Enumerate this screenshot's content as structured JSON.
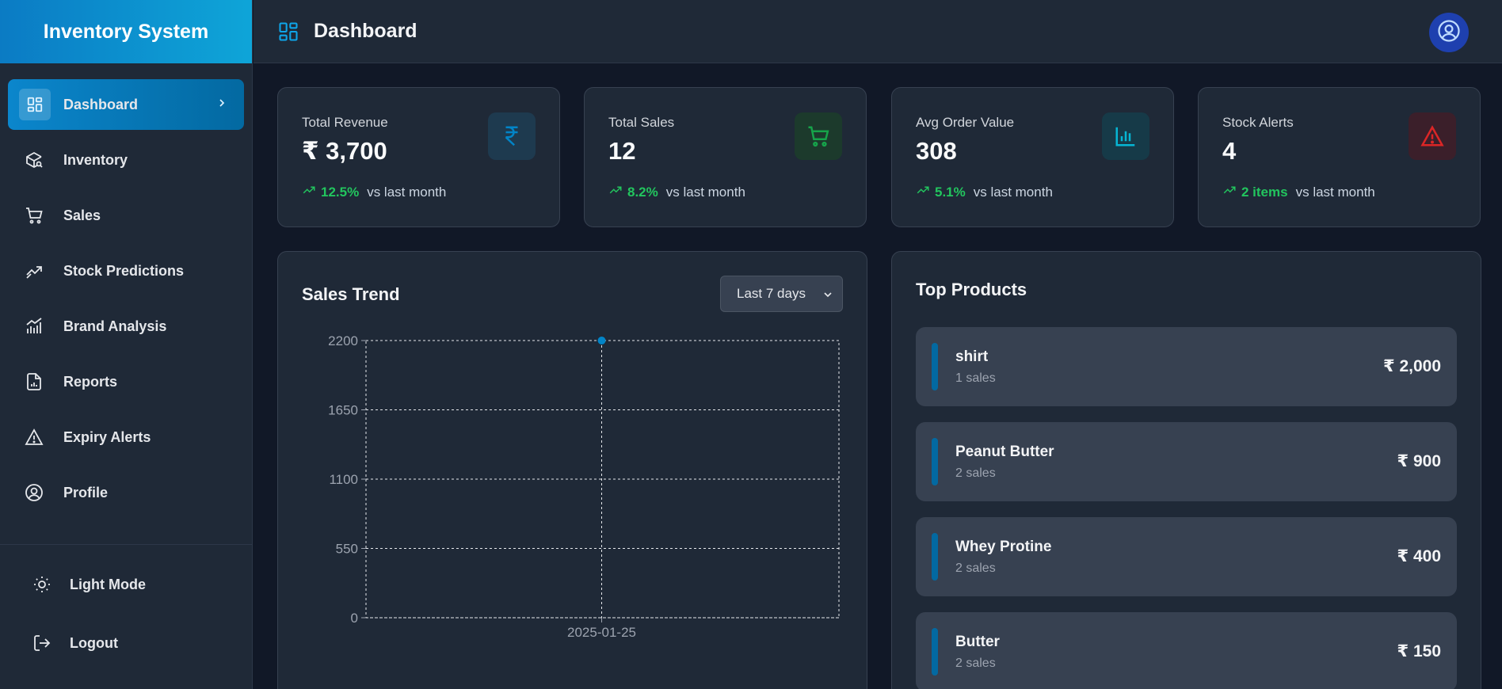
{
  "app": {
    "title": "Inventory System"
  },
  "sidebar": {
    "items": [
      {
        "label": "Dashboard",
        "icon": "dashboard-icon",
        "active": true
      },
      {
        "label": "Inventory",
        "icon": "box-icon"
      },
      {
        "label": "Sales",
        "icon": "cart-icon"
      },
      {
        "label": "Stock Predictions",
        "icon": "trend-up-icon"
      },
      {
        "label": "Brand Analysis",
        "icon": "bar-line-chart-icon"
      },
      {
        "label": "Reports",
        "icon": "report-file-icon"
      },
      {
        "label": "Expiry Alerts",
        "icon": "warning-icon"
      },
      {
        "label": "Profile",
        "icon": "user-circle-icon"
      }
    ],
    "bottom": [
      {
        "label": "Light Mode",
        "icon": "sun-icon"
      },
      {
        "label": "Logout",
        "icon": "logout-icon"
      }
    ]
  },
  "header": {
    "title": "Dashboard"
  },
  "stats": [
    {
      "label": "Total Revenue",
      "value": "₹ 3,700",
      "pct": "12.5%",
      "compare": "vs last month",
      "icon": "rupee-icon",
      "color": "#0284c7"
    },
    {
      "label": "Total Sales",
      "value": "12",
      "pct": "8.2%",
      "compare": "vs last month",
      "icon": "cart-icon",
      "color": "#16a34a"
    },
    {
      "label": "Avg Order Value",
      "value": "308",
      "pct": "5.1%",
      "compare": "vs last month",
      "icon": "bar-chart-icon",
      "color": "#06b6d4"
    },
    {
      "label": "Stock Alerts",
      "value": "4",
      "pct": "2 items",
      "compare": "vs last month",
      "icon": "warning-icon",
      "color": "#dc2626"
    }
  ],
  "sales_trend": {
    "title": "Sales Trend",
    "range_selected": "Last 7 days"
  },
  "top_products": {
    "title": "Top Products",
    "items": [
      {
        "name": "shirt",
        "sales": "1 sales",
        "amount": "₹ 2,000"
      },
      {
        "name": "Peanut Butter",
        "sales": "2 sales",
        "amount": "₹ 900"
      },
      {
        "name": "Whey Protine",
        "sales": "2 sales",
        "amount": "₹ 400"
      },
      {
        "name": "Butter",
        "sales": "2 sales",
        "amount": "₹ 150"
      }
    ]
  },
  "colors": {
    "accent": "#0284c7",
    "background": "#111827",
    "panel": "#1f2937",
    "positive": "#22c55e"
  },
  "chart_data": {
    "type": "line",
    "x": [
      "2025-01-25"
    ],
    "series": [
      {
        "values": [
          2200
        ]
      }
    ],
    "y_ticks": [
      "0",
      "550",
      "1100",
      "1650",
      "2200"
    ],
    "ylim": [
      0,
      2200
    ],
    "grid": true
  }
}
